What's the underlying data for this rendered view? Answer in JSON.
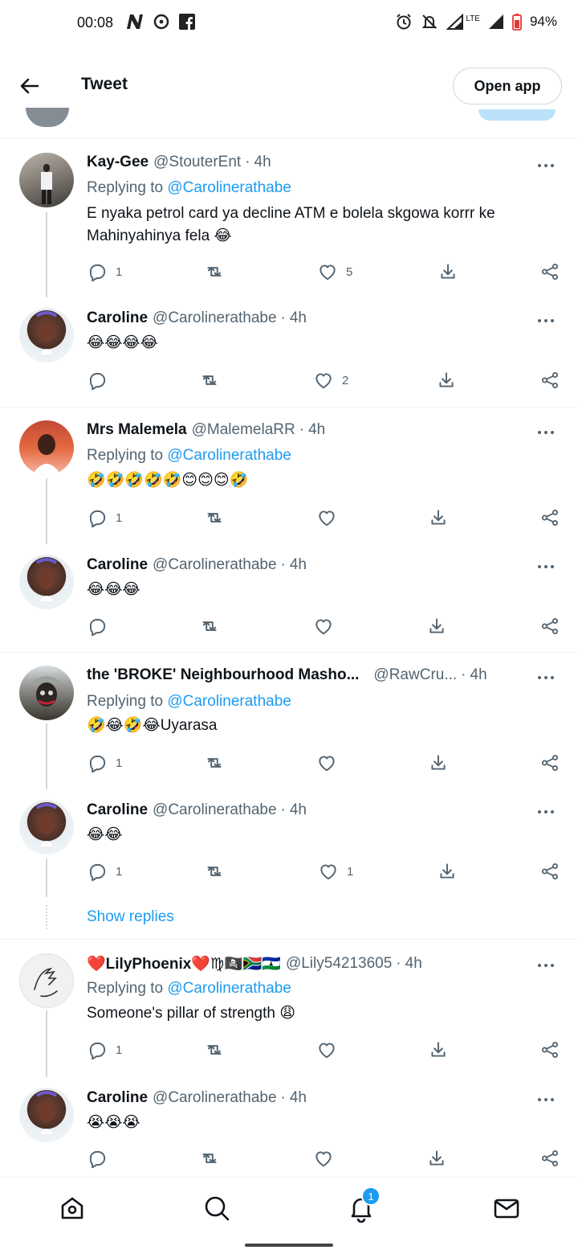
{
  "status_bar": {
    "time": "00:08",
    "battery": "94%",
    "network": "LTE"
  },
  "header": {
    "title": "Tweet",
    "open_app_label": "Open app"
  },
  "tweets": [
    {
      "name": "Kay-Gee",
      "handle": "@StouterEnt",
      "time": "4h",
      "replying_label": "Replying to",
      "replying_to": "@Carolinerathabe",
      "text": "E nyaka petrol card ya decline ATM e bolela skgowa korrr ke Mahinyahinya fela 😂",
      "replies": "1",
      "retweets": "",
      "likes": "5"
    },
    {
      "name": "Caroline",
      "handle": "@Carolinerathabe",
      "time": "4h",
      "text": "😂😂😂😂",
      "replies": "",
      "retweets": "",
      "likes": "2"
    },
    {
      "name": "Mrs Malemela",
      "handle": "@MalemelaRR",
      "time": "4h",
      "replying_label": "Replying to",
      "replying_to": "@Carolinerathabe",
      "text": "🤣🤣🤣🤣🤣😊😊😊🤣",
      "replies": "1",
      "retweets": "",
      "likes": ""
    },
    {
      "name": "Caroline",
      "handle": "@Carolinerathabe",
      "time": "4h",
      "text": "😂😂😂",
      "replies": "",
      "retweets": "",
      "likes": ""
    },
    {
      "name": "the 'BROKE' Neighbourhood Masho...",
      "handle": "@RawCru...",
      "time": "4h",
      "replying_label": "Replying to",
      "replying_to": "@Carolinerathabe",
      "text": "🤣😂🤣😂Uyarasa",
      "replies": "1",
      "retweets": "",
      "likes": ""
    },
    {
      "name": "Caroline",
      "handle": "@Carolinerathabe",
      "time": "4h",
      "text": "😂😂",
      "replies": "1",
      "retweets": "",
      "likes": "1"
    },
    {
      "name": "❤️LilyPhoenix❤️♍🏴‍☠️🇿🇦🇱🇸",
      "handle": "@Lily54213605",
      "time": "4h",
      "replying_label": "Replying to",
      "replying_to": "@Carolinerathabe",
      "text": "Someone's pillar of strength 😩",
      "replies": "1",
      "retweets": "",
      "likes": ""
    },
    {
      "name": "Caroline",
      "handle": "@Carolinerathabe",
      "time": "4h",
      "text": "😭😭😭",
      "replies": "",
      "retweets": "",
      "likes": ""
    }
  ],
  "show_replies_label": "Show replies",
  "bottom_nav": {
    "notifications_badge": "1"
  },
  "colors": {
    "accent": "#1d9bf0",
    "text_primary": "#0f1419",
    "text_secondary": "#536471",
    "divider": "#eff3f4"
  },
  "icons": [
    "back-arrow-icon",
    "reply-icon",
    "retweet-icon",
    "like-icon",
    "download-icon",
    "share-icon",
    "more-icon",
    "home-icon",
    "search-icon",
    "notifications-icon",
    "messages-icon"
  ]
}
